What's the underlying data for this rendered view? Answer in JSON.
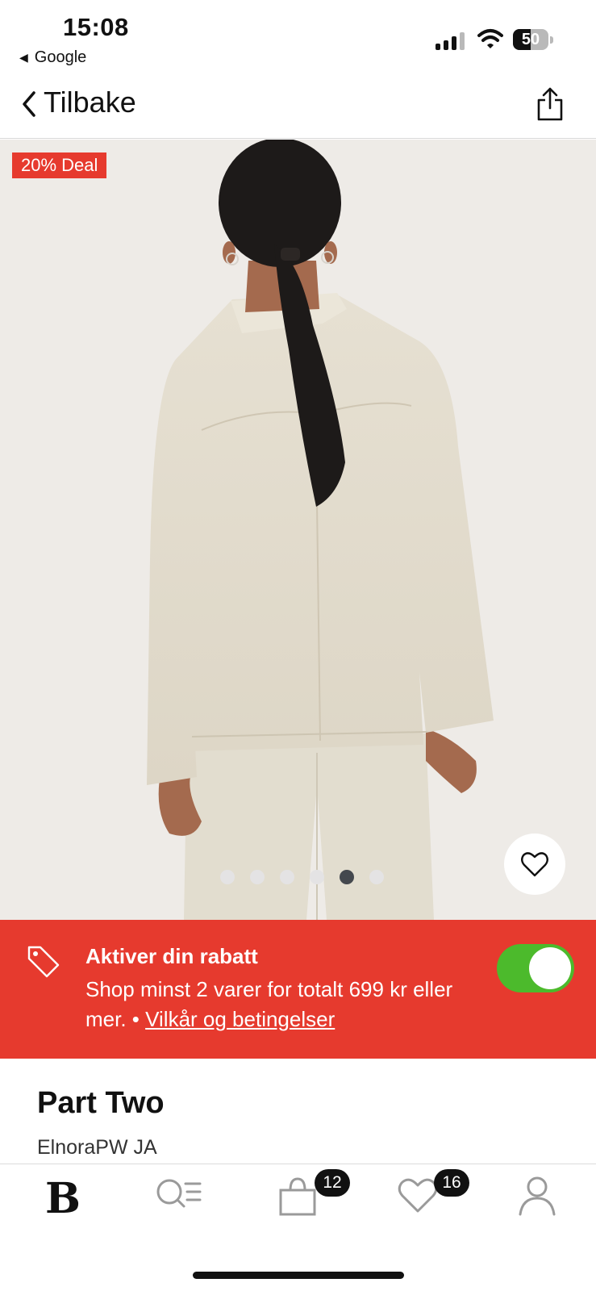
{
  "status_bar": {
    "time": "15:08",
    "back_app": "Google",
    "battery": "50",
    "battery_level": 0.5
  },
  "nav": {
    "back_label": "Tilbake"
  },
  "hero": {
    "deal_badge": "20% Deal",
    "image_count": 6,
    "active_image_index": 4
  },
  "promo": {
    "title": "Aktiver din rabatt",
    "text": "Shop minst 2 varer for totalt 699 kr eller mer. •",
    "link": "Vilkår og betingelser",
    "toggle_on": true
  },
  "product": {
    "brand": "Part Two",
    "name": "ElnoraPW JA"
  },
  "tabbar": {
    "logo": "B",
    "cart_count": "12",
    "wishlist_count": "16"
  },
  "colors": {
    "accent_red": "#e63a2e",
    "toggle_green": "#4cba2c",
    "hero_bg": "#eeebe7"
  }
}
